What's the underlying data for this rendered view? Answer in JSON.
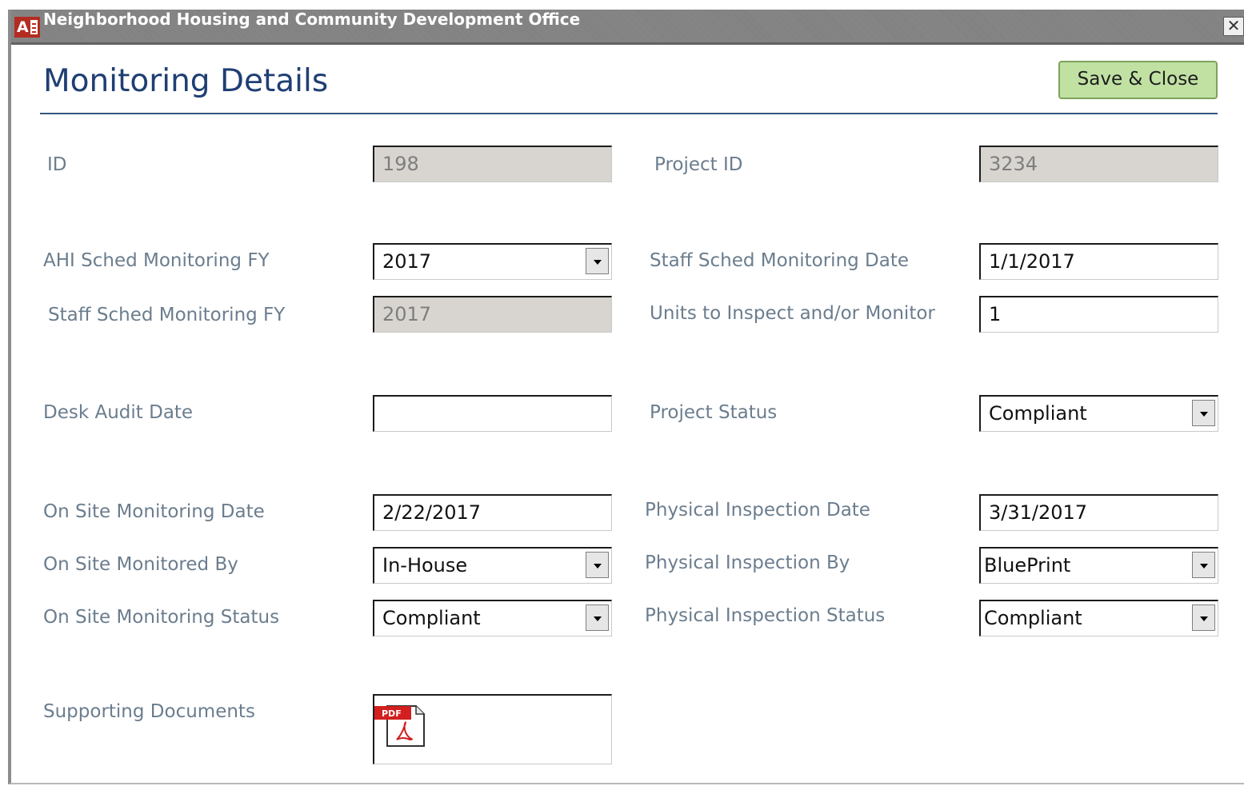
{
  "window": {
    "title": "Neighborhood Housing and Community Development Office",
    "app_icon_letter": "A",
    "close_glyph": "✕"
  },
  "header": {
    "title": "Monitoring Details",
    "save_close_label": "Save & Close"
  },
  "fields": {
    "id": {
      "label": "ID",
      "value": "198"
    },
    "project_id": {
      "label": "Project ID",
      "value": "3234"
    },
    "ahi_sched_fy": {
      "label": "AHI Sched Monitoring FY",
      "value": "2017"
    },
    "staff_sched_date": {
      "label": "Staff Sched Monitoring Date",
      "value": "1/1/2017"
    },
    "staff_sched_fy": {
      "label": "Staff Sched Monitoring FY",
      "value": "2017"
    },
    "units": {
      "label": "Units to Inspect and/or Monitor",
      "value": "1"
    },
    "desk_audit_date": {
      "label": "Desk Audit Date",
      "value": ""
    },
    "project_status": {
      "label": "Project Status",
      "value": "Compliant"
    },
    "on_site_date": {
      "label": "On Site Monitoring Date",
      "value": "2/22/2017"
    },
    "physical_date": {
      "label": "Physical Inspection Date",
      "value": "3/31/2017"
    },
    "on_site_by": {
      "label": "On Site Monitored By",
      "value": "In-House"
    },
    "physical_by": {
      "label": "Physical Inspection By",
      "value": "BluePrint"
    },
    "on_site_status": {
      "label": "On Site Monitoring Status",
      "value": "Compliant"
    },
    "physical_status": {
      "label": "Physical Inspection Status",
      "value": "Compliant"
    },
    "supporting_docs": {
      "label": "Supporting Documents",
      "attachment_icon": "pdf-file-icon",
      "attachment_badge": "PDF"
    }
  },
  "colors": {
    "title_blue": "#1f3f73",
    "label_gray": "#6b7d8e",
    "save_green": "#c1e1a3",
    "locked_field": "#d8d5d0",
    "pdf_red": "#d21f1f"
  }
}
